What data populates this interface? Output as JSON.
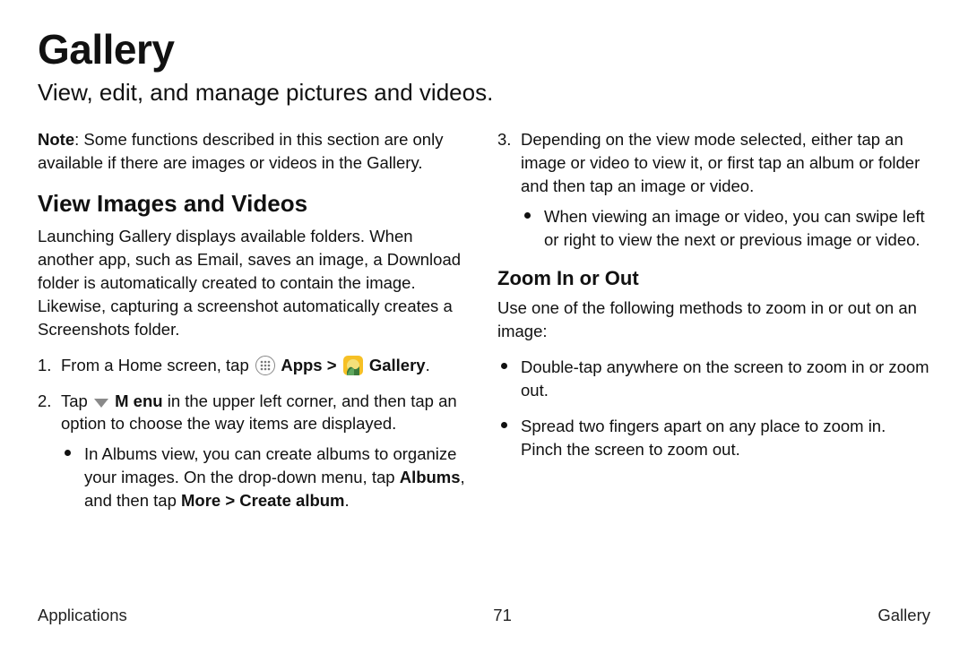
{
  "title": "Gallery",
  "subtitle": "View, edit, and manage pictures and videos.",
  "note_label": "Note",
  "note_body": ": Some functions described in this section are only available if there are images or videos in the Gallery.",
  "section_view": "View Images and Videos",
  "view_intro": "Launching Gallery displays available folders. When another app, such as Email, saves an image, a Download folder is automatically created to contain the image. Likewise, capturing a screenshot automatically creates a Screenshots folder.",
  "step1_pre": "From a Home screen, tap ",
  "step1_apps": " Apps",
  "step1_sep": " > ",
  "step1_gallery": " Gallery",
  "step1_end": ".",
  "step2_pre": "Tap ",
  "step2_menu": " M enu",
  "step2_post": " in the upper left corner, and then tap an option to choose the way items are displayed.",
  "step2_sub_pre": "In Albums view, you can create albums to organize your images. On the drop‑down menu, tap ",
  "step2_sub_b1": "Albums",
  "step2_sub_mid": ", and then tap ",
  "step2_sub_b2": "More > Create album",
  "step2_sub_end": ".",
  "step3": "Depending on the view mode selected, either tap an image or video to view it, or first tap an album or folder and then tap an image or video.",
  "step3_sub": "When viewing an image or video, you can swipe left or right to view the next or previous image or video.",
  "section_zoom": "Zoom In or Out",
  "zoom_intro": "Use one of the following methods to zoom in or out on an image:",
  "zoom_b1": "Double‑tap anywhere on the screen to zoom in or zoom out.",
  "zoom_b2": "Spread two fingers apart on any place to zoom in. Pinch the screen to zoom out.",
  "footer_left": "Applications",
  "footer_center": "71",
  "footer_right": "Gallery"
}
